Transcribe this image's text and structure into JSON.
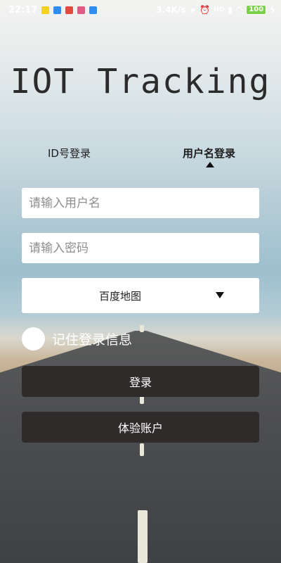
{
  "statusbar": {
    "time": "22:17",
    "speed": "3.4K/s",
    "network": "HD",
    "battery": "100"
  },
  "title": "IOT Tracking",
  "tabs": {
    "id_login": "ID号登录",
    "user_login": "用户名登录"
  },
  "form": {
    "username_placeholder": "请输入用户名",
    "password_placeholder": "请输入密码",
    "map_selected": "百度地图",
    "remember_label": "记住登录信息"
  },
  "buttons": {
    "login": "登录",
    "demo": "体验账户"
  }
}
